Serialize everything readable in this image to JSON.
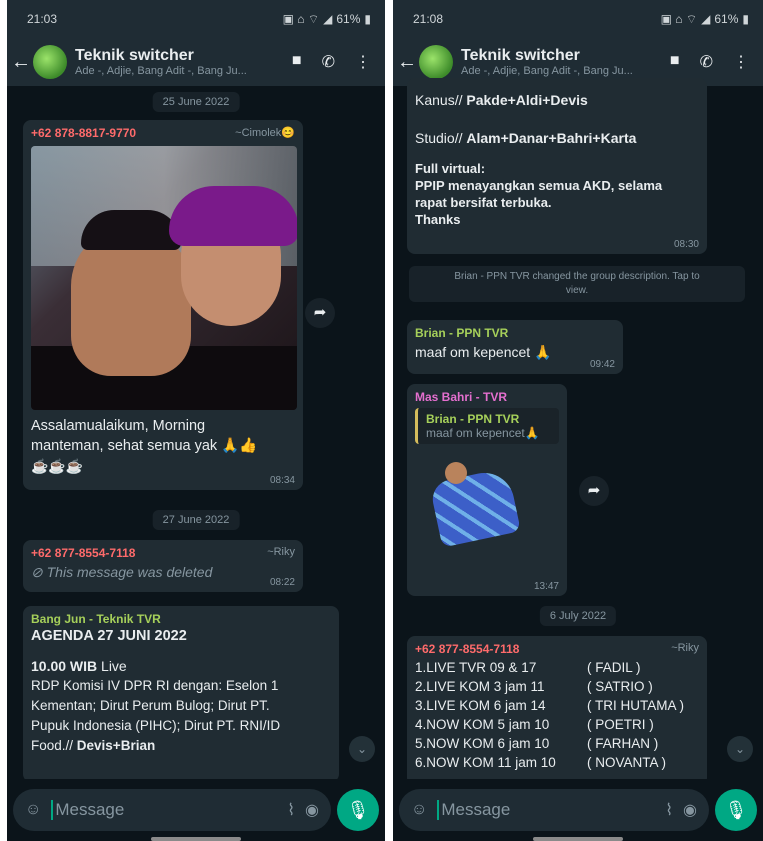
{
  "left": {
    "status": {
      "time": "21:03",
      "battery": "61%"
    },
    "header": {
      "title": "Teknik switcher",
      "subtitle": "Ade -, Adjie, Bang Adit -, Bang Ju..."
    },
    "date1": "25 June 2022",
    "msg1": {
      "sender": "+62 878-8817-9770",
      "alias": "~Cimolek😊",
      "line1": "Assalamualaikum, Morning",
      "line2": "manteman, sehat semua yak 🙏👍",
      "line3": "☕☕☕",
      "time": "08:34"
    },
    "date2": "27 June 2022",
    "msg2": {
      "sender": "+62 877-8554-7118",
      "alias": "~Riky",
      "deleted": "This message was deleted",
      "time": "08:22"
    },
    "msg3": {
      "sender": "Bang Jun - Teknik TVR",
      "title": "AGENDA 27 JUNI 2022",
      "time_label": "10.00 WIB",
      "live": " Live",
      "line1": " RDP Komisi IV DPR RI dengan: Eselon 1",
      "line2": "Kementan; Dirut Perum Bulog; Dirut PT.",
      "line3": "Pupuk Indonesia (PIHC); Dirut PT. RNI/ID",
      "line4a": "Food.// ",
      "line4b": "Devis+Brian"
    },
    "input_placeholder": "Message"
  },
  "right": {
    "status": {
      "time": "21:08",
      "battery": "61%"
    },
    "header": {
      "title": "Teknik switcher",
      "subtitle": "Ade -, Adjie, Bang Adit -, Bang Ju..."
    },
    "msg1": {
      "kanus_label": "Kanus// ",
      "kanus_names": "Pakde+Aldi+Devis",
      "studio_label": "Studio// ",
      "studio_names": "Alam+Danar+Bahri+Karta",
      "fv_title": "Full virtual:",
      "fv1": "PPIP menayangkan semua AKD, selama",
      "fv2": "rapat bersifat terbuka.",
      "fv3": "Thanks",
      "time": "08:30"
    },
    "sysnote1": "Brian - PPN TVR changed the group description. Tap to",
    "sysnote2": "view.",
    "msg2": {
      "sender": "Brian - PPN TVR",
      "text": "maaf om kepencet 🙏",
      "time": "09:42"
    },
    "msg3": {
      "sender": "Mas Bahri - TVR",
      "quote_sender": "Brian - PPN TVR",
      "quote_text": "maaf om kepencet🙏",
      "time": "13:47"
    },
    "date1": "6 July 2022",
    "msg4": {
      "sender": "+62 877-8554-7118",
      "alias": "~Riky",
      "rows": [
        {
          "left": "1.LIVE TVR 09 & 17",
          "right": "( FADIL )"
        },
        {
          "left": "2.LIVE KOM 3 jam 11",
          "right": "( SATRIO )"
        },
        {
          "left": "3.LIVE KOM 6 jam 14",
          "right": "( TRI HUTAMA )"
        },
        {
          "left": "4.NOW KOM 5 jam 10",
          "right": "( POETRI )"
        },
        {
          "left": "5.NOW KOM 6 jam 10",
          "right": "( FARHAN )"
        },
        {
          "left": "6.NOW KOM 11 jam 10",
          "right": "( NOVANTA )"
        }
      ]
    },
    "input_placeholder": "Message"
  },
  "colors": {
    "accent": "#00a884",
    "sender_red": "#ff6b6b",
    "sender_green": "#53bdeb",
    "sender_pink": "#e56fcf",
    "sender_yellowgreen": "#a6d05a"
  }
}
